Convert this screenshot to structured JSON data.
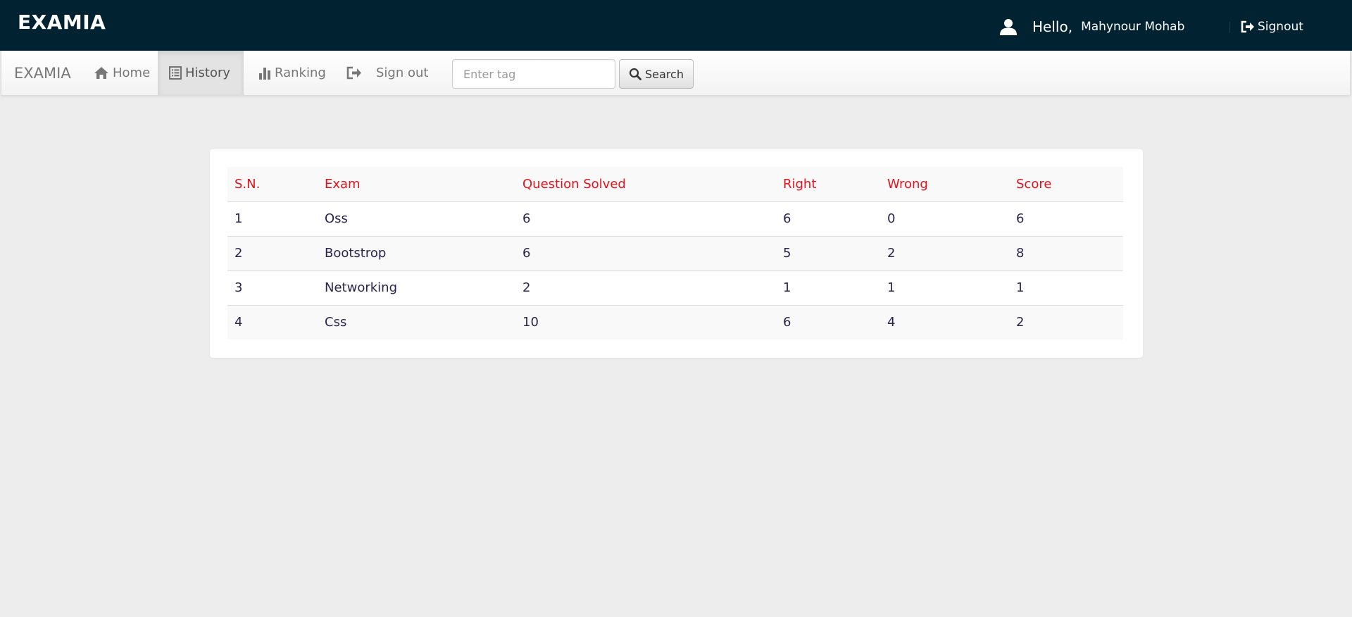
{
  "header": {
    "brand": "EXAMIA",
    "greeting": "Hello,",
    "user_name": "Mahynour Mohab",
    "signout_label": "Signout"
  },
  "navbar": {
    "brand": "EXAMIA",
    "items": [
      {
        "label": "Home",
        "icon": "home-icon",
        "active": false
      },
      {
        "label": "History",
        "icon": "list-icon",
        "active": true
      },
      {
        "label": "Ranking",
        "icon": "bar-chart-icon",
        "active": false
      },
      {
        "label": "Sign out",
        "icon": "log-out-icon",
        "active": false
      }
    ],
    "search": {
      "placeholder": "Enter tag",
      "value": "",
      "button_label": "Search"
    }
  },
  "history_table": {
    "columns": [
      "S.N.",
      "Exam",
      "Question Solved",
      "Right",
      "Wrong",
      "Score"
    ],
    "rows": [
      [
        "1",
        "Oss",
        "6",
        "6",
        "0",
        "6"
      ],
      [
        "2",
        "Bootstrop",
        "6",
        "5",
        "2",
        "8"
      ],
      [
        "3",
        "Networking",
        "2",
        "1",
        "1",
        "1"
      ],
      [
        "4",
        "Css",
        "10",
        "6",
        "4",
        "2"
      ]
    ]
  },
  "colors": {
    "header_bg": "#012231",
    "page_bg": "#ededed",
    "table_header_text": "#e8101a",
    "table_body_text": "#2a2550"
  }
}
